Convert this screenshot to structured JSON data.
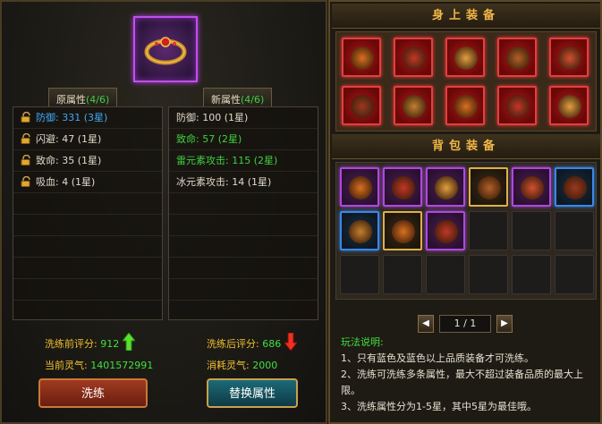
{
  "left": {
    "tabs": {
      "original": {
        "label": "原属性",
        "count": "(4/6)"
      },
      "new": {
        "label": "新属性",
        "count": "(4/6)"
      }
    },
    "original_attrs": [
      {
        "text": "防御: 331 (3星)",
        "color": "#40a8f8"
      },
      {
        "text": "闪避: 47 (1星)",
        "color": "#e0d8c8"
      },
      {
        "text": "致命: 35 (1星)",
        "color": "#e0d8c8"
      },
      {
        "text": "吸血: 4 (1星)",
        "color": "#e0d8c8"
      }
    ],
    "new_attrs": [
      {
        "text": "防御: 100 (1星)",
        "color": "#e0d8c8"
      },
      {
        "text": "致命: 57 (2星)",
        "color": "#40d040"
      },
      {
        "text": "雷元素攻击: 115 (2星)",
        "color": "#40d040"
      },
      {
        "text": "冰元素攻击: 14 (1星)",
        "color": "#e0d8c8"
      }
    ],
    "score_before_label": "洗练前评分:",
    "score_before": "912",
    "score_after_label": "洗练后评分:",
    "score_after": "686",
    "spirit_label": "当前灵气:",
    "spirit_value": "1401572991",
    "cost_label": "消耗灵气:",
    "cost_value": "2000",
    "refine_button": "洗练",
    "replace_button": "替换属性"
  },
  "right": {
    "equipped_title": "身上装备",
    "bag_title": "背包装备",
    "equipped_items": [
      "red",
      "red",
      "red",
      "red",
      "red",
      "red",
      "red",
      "red",
      "red",
      "red"
    ],
    "bag_items": [
      "purple",
      "purple",
      "purple",
      "gold",
      "purple",
      "blue",
      "blue",
      "gold",
      "purple",
      "empty",
      "empty",
      "empty",
      "empty",
      "empty",
      "empty",
      "empty",
      "empty",
      "empty"
    ],
    "pager": {
      "text": "1 / 1",
      "prev": "◀",
      "next": "▶"
    },
    "rules_title": "玩法说明:",
    "rules": [
      "1、只有蓝色及蓝色以上品质装备才可洗练。",
      "2、洗练可洗练多条属性，最大不超过装备品质的最大上限。",
      "3、洗练属性分为1-5星，其中5星为最佳哦。"
    ]
  }
}
